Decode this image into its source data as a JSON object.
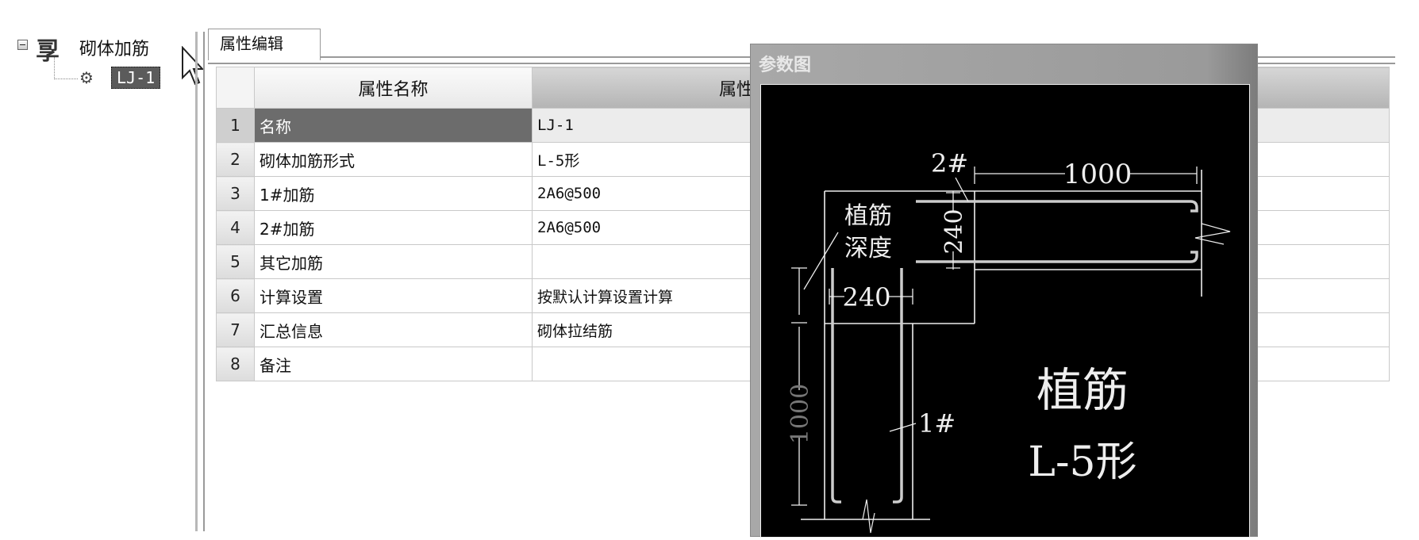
{
  "tree": {
    "root_label": "砌体加筋",
    "child_label": "LJ-1"
  },
  "tab": {
    "label": "属性编辑"
  },
  "grid": {
    "headers": {
      "name": "属性名称",
      "value": "属性值"
    },
    "rows": [
      {
        "num": "1",
        "name": "名称",
        "value": "LJ-1"
      },
      {
        "num": "2",
        "name": "砌体加筋形式",
        "value": "L-5形"
      },
      {
        "num": "3",
        "name": "1#加筋",
        "value": "2A6@500"
      },
      {
        "num": "4",
        "name": "2#加筋",
        "value": "2A6@500"
      },
      {
        "num": "5",
        "name": "其它加筋",
        "value": ""
      },
      {
        "num": "6",
        "name": "计算设置",
        "value": "按默认计算设置计算"
      },
      {
        "num": "7",
        "name": "汇总信息",
        "value": "砌体拉结筋"
      },
      {
        "num": "8",
        "name": "备注",
        "value": ""
      }
    ],
    "selected_row": 1
  },
  "panel": {
    "title": "参数图",
    "diagram": {
      "label_2": "2#",
      "label_1": "1#",
      "dim_top": "1000",
      "dim_left": "1000",
      "dim_vertical_240": "240",
      "dim_horizontal_240": "240",
      "depth_line1": "植筋",
      "depth_line2": "深度",
      "big_title": "植筋",
      "big_subtitle": "L-5形"
    }
  }
}
